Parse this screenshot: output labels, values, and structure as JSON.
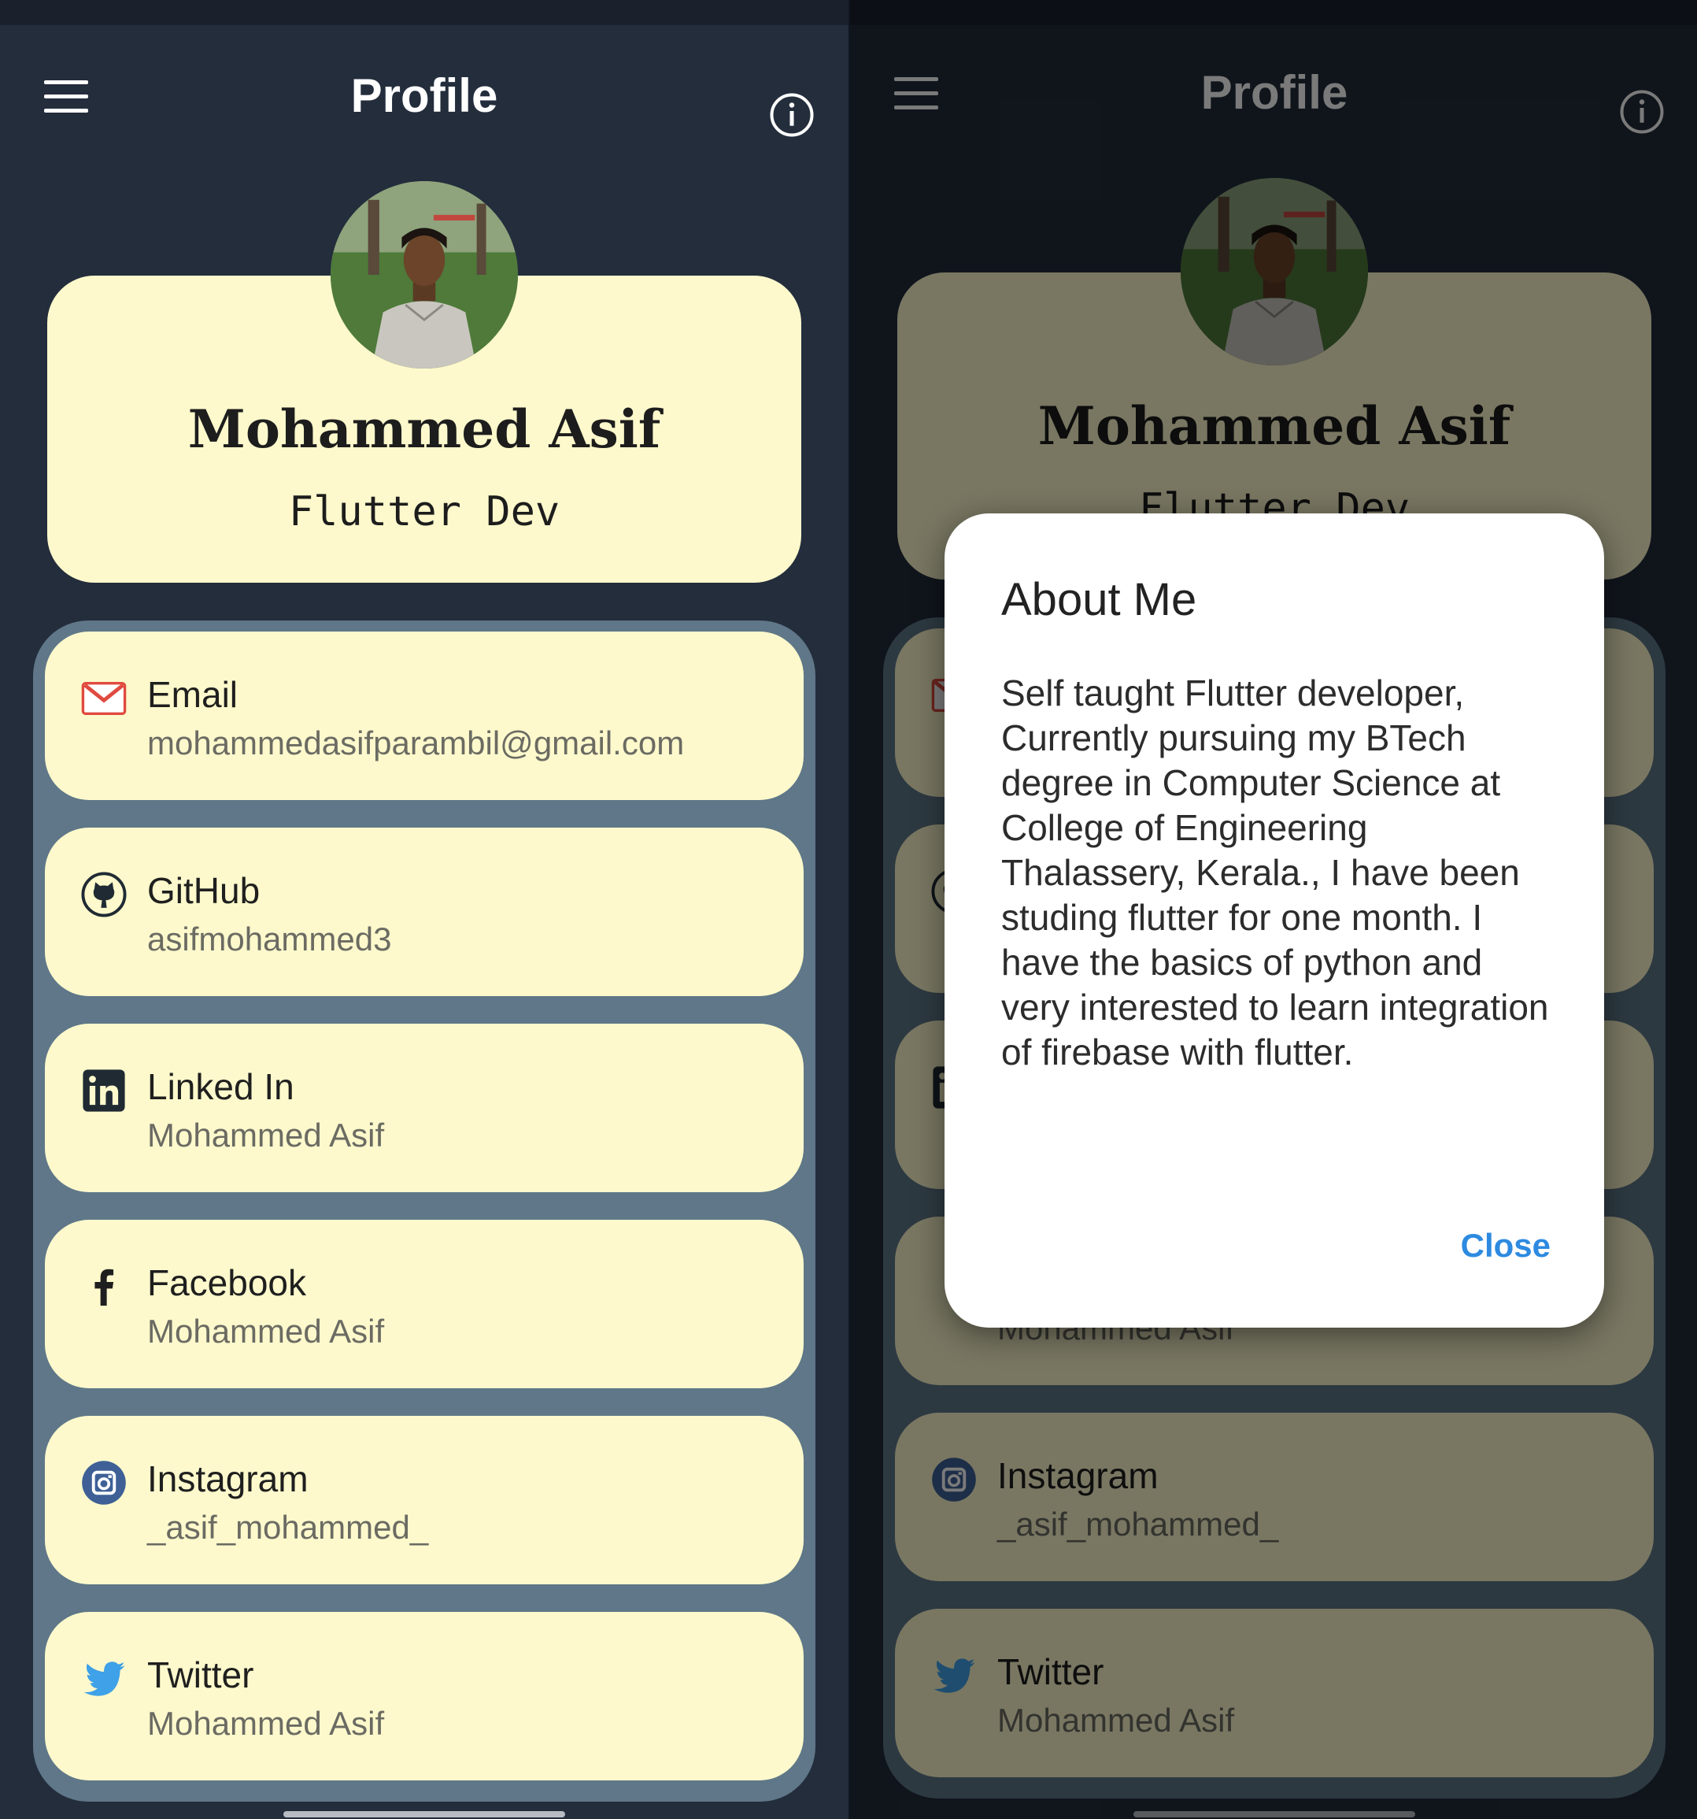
{
  "app": {
    "title": "Profile"
  },
  "profile": {
    "name": "Mohammed Asif",
    "role": "Flutter Dev"
  },
  "contacts": [
    {
      "title": "Email",
      "value": "mohammedasifparambil@gmail.com",
      "icon": "mail-icon"
    },
    {
      "title": "GitHub",
      "value": "asifmohammed3",
      "icon": "github-icon"
    },
    {
      "title": "Linked In",
      "value": "Mohammed Asif",
      "icon": "linkedin-icon"
    },
    {
      "title": "Facebook",
      "value": "Mohammed Asif",
      "icon": "facebook-icon"
    },
    {
      "title": "Instagram",
      "value": "_asif_mohammed_",
      "icon": "instagram-icon"
    },
    {
      "title": "Twitter",
      "value": "Mohammed Asif",
      "icon": "twitter-icon"
    }
  ],
  "dialog": {
    "title": "About Me",
    "body": "Self taught Flutter developer, Currently pursuing my BTech degree in Computer Science at College of Engineering Thalassery, Kerala., I have been studing flutter for one month. I have the basics of python and very interested to learn integration of firebase with flutter.",
    "close_label": "Close"
  },
  "colors": {
    "background": "#232d3c",
    "card": "#fdf9cc",
    "list_panel": "#5f7788",
    "accent": "#2d8ae0"
  }
}
